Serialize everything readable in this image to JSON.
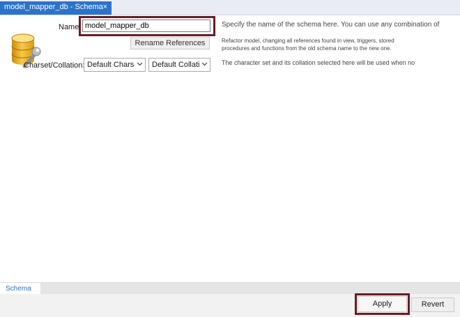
{
  "tab": {
    "title": "model_mapper_db - Schema",
    "close": "×"
  },
  "form": {
    "name_label": "Name:",
    "name_value": "model_mapper_db",
    "rename_button": "Rename References",
    "charset_label": "Charset/Collation:",
    "charset_value": "Default Charset",
    "collation_value": "Default Collation"
  },
  "descriptions": {
    "name": "Specify the name of the schema here. You can use any combination of",
    "rename_line1": "Refactor model, changing all references found in view, triggers, stored",
    "rename_line2": "procedures and functions from the old schema name to the new one.",
    "charset": "The character set and its collation selected here will be used when no"
  },
  "bottom_tabs": [
    "Schema"
  ],
  "buttons": {
    "apply": "Apply",
    "revert": "Revert"
  },
  "colors": {
    "accent": "#2b73c9",
    "highlight": "#6b1a24"
  },
  "icons": {
    "schema": "database-wrench-icon",
    "chevron": "chevron-down-icon"
  }
}
